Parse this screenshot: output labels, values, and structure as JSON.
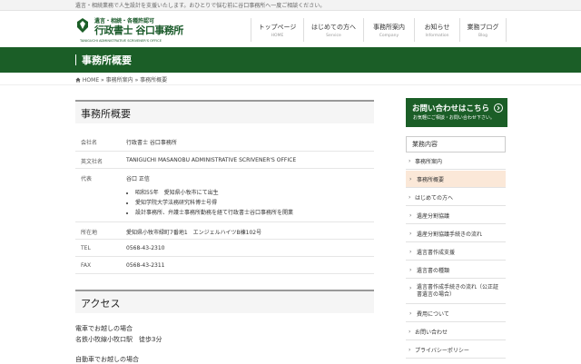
{
  "topbar": {
    "text": "遺言・相続業務で人生設計を支援いたします。おひとりで悩む前に谷口事務所へ一度ご相談ください。"
  },
  "logo": {
    "line1": "遺言・相続・各種許認可",
    "line2": "行政書士 谷口事務所",
    "line3": "TANIGUCHI ADMINISTRATIVE SCRIVENER'S OFFICE"
  },
  "nav": [
    {
      "jp": "トップページ",
      "en": "HOME"
    },
    {
      "jp": "はじめての方へ",
      "en": "Service"
    },
    {
      "jp": "事務所案内",
      "en": "Company"
    },
    {
      "jp": "お知らせ",
      "en": "Information"
    },
    {
      "jp": "業務ブログ",
      "en": "Blog"
    }
  ],
  "band": {
    "title": "事務所概要"
  },
  "breadcrumb": {
    "home": "HOME",
    "sep1": "»",
    "parent": "事務所案内",
    "sep2": "»",
    "current": "事務所概要"
  },
  "main": {
    "heading": "事務所概要",
    "rows": [
      {
        "key": "会社名",
        "value": "行政書士 谷口事務所"
      },
      {
        "key": "英文社名",
        "value": "TANIGUCHI MASANOBU ADMINISTRATIVE SCRIVENER'S OFFICE"
      },
      {
        "key": "代表",
        "value": "谷口 正信",
        "bullets": [
          "昭和55年　愛知県小牧市にて出生",
          "愛知学院大学法務研究科博士号得",
          "設計事務所、弁護士事務所勤務を経て行政書士谷口事務所を開業"
        ]
      },
      {
        "key": "所在地",
        "value": "愛知県小牧市緑町7番地1　エンジェルハイツB棟102号"
      },
      {
        "key": "TEL",
        "value": "0568-43-2310"
      },
      {
        "key": "FAX",
        "value": "0568-43-2311"
      }
    ],
    "access_heading": "アクセス",
    "access_p1": "電車でお越しの場合",
    "access_p2": "名鉄小牧線小牧口駅　徒歩3分",
    "access_p3": "自動車でお越しの場合"
  },
  "sidebar": {
    "cta_title": "お問い合わせはこちら",
    "cta_sub": "お気軽にご相談・お問い合わせ下さい。",
    "menu_heading": "業務内容",
    "items": [
      {
        "label": "事務所案内",
        "level": 0
      },
      {
        "label": "事務所概要",
        "level": 1,
        "active": true
      },
      {
        "label": "はじめての方へ",
        "level": 0
      },
      {
        "label": "遺産分割協議",
        "level": 1
      },
      {
        "label": "遺産分割協議手続きの流れ",
        "level": 1
      },
      {
        "label": "遺言書作成支援",
        "level": 1
      },
      {
        "label": "遺言書の種類",
        "level": 1
      },
      {
        "label": "遺言書作成手続きの流れ（公正証書遺言の場合）",
        "level": 1
      },
      {
        "label": "費用について",
        "level": 1
      },
      {
        "label": "お問い合わせ",
        "level": 0
      },
      {
        "label": "プライバシーポリシー",
        "level": 0
      }
    ]
  },
  "colors": {
    "brand": "#1b5e27",
    "active_item": "#fbe8d8"
  }
}
